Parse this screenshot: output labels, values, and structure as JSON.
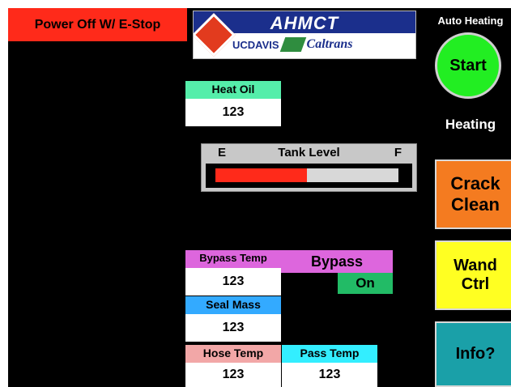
{
  "estop_label": "Power Off W/ E-Stop",
  "logo": {
    "title": "AHMCT",
    "ucdavis": "UCDAVIS",
    "caltrans": "Caltrans"
  },
  "auto_heating": {
    "title": "Auto Heating",
    "start_label": "Start",
    "heating_label": "Heating"
  },
  "heat_oil": {
    "label": "Heat Oil",
    "value": "123"
  },
  "tank": {
    "empty_label": "E",
    "title": "Tank Level",
    "full_label": "F",
    "level_fraction": 0.5
  },
  "bypass": {
    "temp_label": "Bypass Temp",
    "temp_value": "123",
    "label": "Bypass",
    "state": "On"
  },
  "seal_mass": {
    "label": "Seal Mass",
    "value": "123"
  },
  "hose_temp": {
    "label": "Hose Temp",
    "value": "123"
  },
  "pass_temp": {
    "label": "Pass Temp",
    "value": "123"
  },
  "buttons": {
    "crack_clean_line1": "Crack",
    "crack_clean_line2": "Clean",
    "wand_ctrl_line1": "Wand",
    "wand_ctrl_line2": "Ctrl",
    "info": "Info?"
  },
  "colors": {
    "estop": "#ff2a1a",
    "start": "#22ee22",
    "heat_oil": "#55eeaa",
    "bypass": "#dd66dd",
    "bypass_on": "#22bb66",
    "seal_mass": "#33aaff",
    "hose_temp": "#f2a7a7",
    "pass_temp": "#33eeff",
    "crack_clean": "#f47b20",
    "wand_ctrl": "#ffff22",
    "info": "#1aa0a8",
    "tank_fill": "#ff2a1a"
  }
}
